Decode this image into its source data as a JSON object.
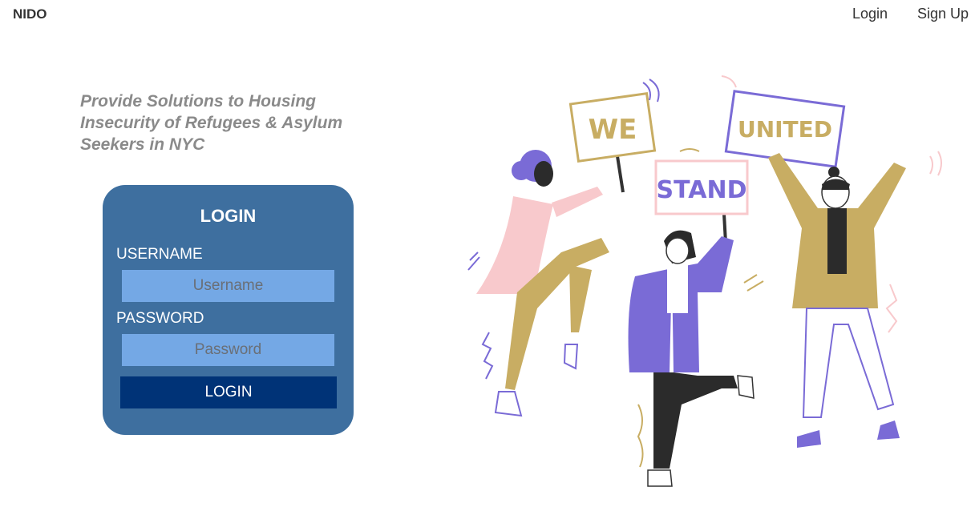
{
  "nav": {
    "brand": "NIDO",
    "login": "Login",
    "signup": "Sign Up"
  },
  "hero": {
    "tagline": "Provide Solutions to Housing Insecurity of Refugees & Asylum Seekers in NYC"
  },
  "login_form": {
    "title": "LOGIN",
    "username_label": "USERNAME",
    "username_placeholder": "Username",
    "username_value": "",
    "password_label": "PASSWORD",
    "password_placeholder": "Password",
    "password_value": "",
    "submit_label": "LOGIN"
  },
  "illustration": {
    "signs": [
      "WE",
      "STAND",
      "UNITED"
    ]
  },
  "colors": {
    "card": "#3e6f9f",
    "input": "#74a8e5",
    "button": "#003377",
    "purple": "#7a6bd6",
    "pink": "#f8c9cc",
    "mustard": "#c8ad63"
  }
}
